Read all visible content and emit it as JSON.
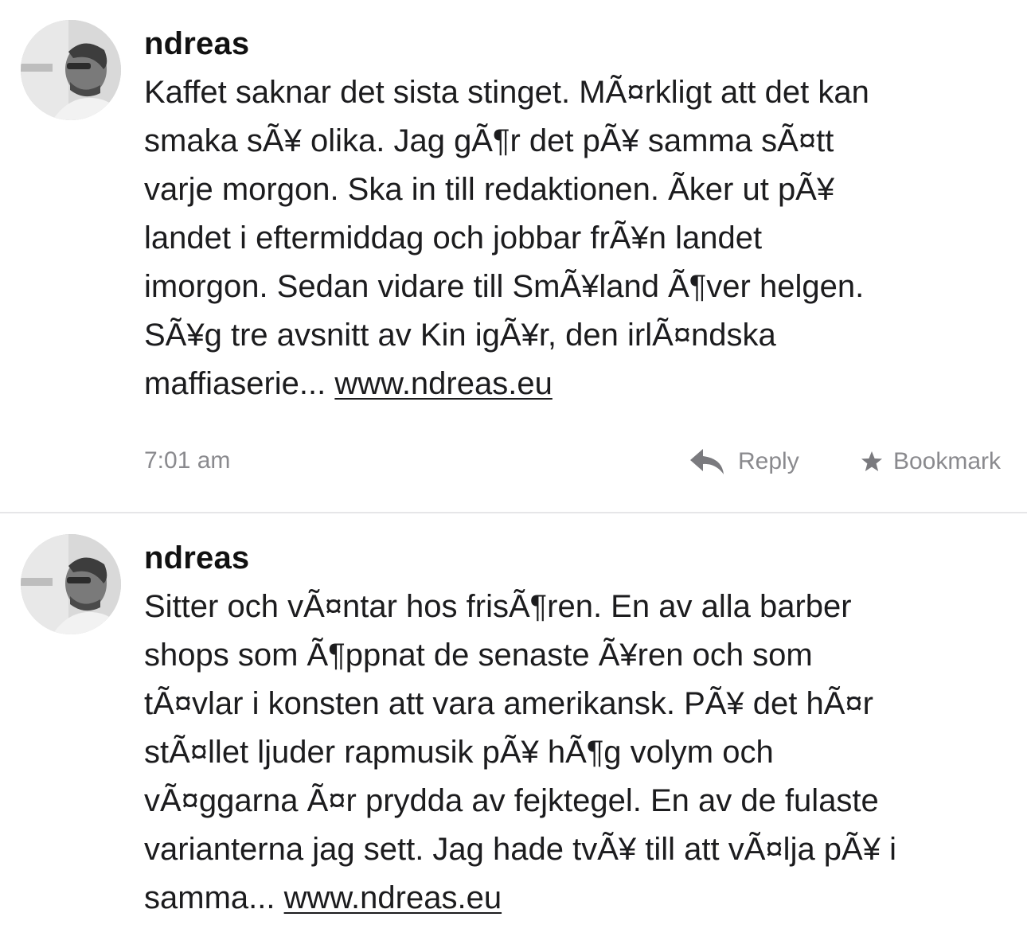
{
  "posts": [
    {
      "username": "ndreas",
      "lines": [
        "Kaffet saknar det sista stinget. MÃ¤rkligt att det kan",
        "smaka sÃ¥ olika. Jag gÃ¶r det pÃ¥ samma sÃ¤tt",
        "varje morgon. Ska in till redaktionen. Ãker ut pÃ¥",
        "landet i eftermiddag och jobbar frÃ¥n landet",
        "imorgon. Sedan vidare till SmÃ¥land Ã¶ver helgen.",
        "SÃ¥g tre avsnitt av Kin igÃ¥r, den irlÃ¤ndska"
      ],
      "last_line": "maffiaserie... ",
      "link": "www.ndreas.eu",
      "timestamp": "7:01 am",
      "reply_label": "Reply",
      "bookmark_label": "Bookmark"
    },
    {
      "username": "ndreas",
      "lines": [
        "Sitter och vÃ¤ntar hos frisÃ¶ren. En av alla barber",
        "shops som Ã¶ppnat de senaste Ã¥ren och som",
        "tÃ¤vlar i konsten att vara amerikansk. PÃ¥ det hÃ¤r",
        "stÃ¤llet ljuder rapmusik pÃ¥ hÃ¶g volym och",
        "vÃ¤ggarna Ã¤r prydda av fejktegel. En av de fulaste",
        "varianterna jag sett. Jag hade tvÃ¥ till att vÃ¤lja pÃ¥ i"
      ],
      "last_line": "samma... ",
      "link": "www.ndreas.eu"
    }
  ],
  "icons": {
    "reply": "reply-arrow-icon",
    "bookmark": "star-icon",
    "avatar": "avatar-photo"
  },
  "colors": {
    "text": "#1c1c1e",
    "secondary": "#8a8a8e",
    "divider": "#e6e6e8"
  }
}
